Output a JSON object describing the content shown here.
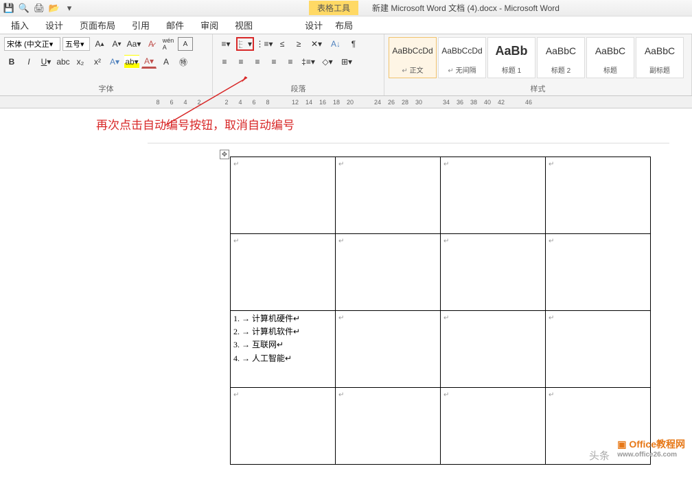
{
  "titlebar": {
    "table_tools": "表格工具",
    "doc_title": "新建 Microsoft Word 文档 (4).docx - Microsoft Word"
  },
  "tabs": {
    "insert": "插入",
    "design": "设计",
    "pagelayout": "页面布局",
    "references": "引用",
    "mailings": "邮件",
    "review": "审阅",
    "view": "视图",
    "table_design": "设计",
    "table_layout": "布局"
  },
  "font": {
    "name": "宋体 (中文正",
    "size": "五号",
    "group_label": "字体"
  },
  "paragraph": {
    "group_label": "段落"
  },
  "styles": {
    "group_label": "样式",
    "items": [
      {
        "preview": "AaBbCcDd",
        "name": "正文",
        "selected": true,
        "has_mark": true
      },
      {
        "preview": "AaBbCcDd",
        "name": "无间隔",
        "has_mark": true
      },
      {
        "preview": "AaBb",
        "name": "标题 1",
        "big": true
      },
      {
        "preview": "AaBbC",
        "name": "标题 2",
        "med": true
      },
      {
        "preview": "AaBbC",
        "name": "标题",
        "med": true
      },
      {
        "preview": "AaBbC",
        "name": "副标题",
        "med": true
      }
    ]
  },
  "ruler": [
    "8",
    "6",
    "4",
    "2",
    "",
    "2",
    "4",
    "6",
    "8",
    "",
    "12",
    "14",
    "16",
    "18",
    "20",
    "",
    "24",
    "26",
    "28",
    "30",
    "",
    "34",
    "36",
    "38",
    "40",
    "42",
    "",
    "46"
  ],
  "annotation": "再次点击自动编号按钮，取消自动编号",
  "table": {
    "list_items": [
      {
        "num": "1.",
        "text": "计算机硬件"
      },
      {
        "num": "2.",
        "text": "计算机软件"
      },
      {
        "num": "3.",
        "text": "互联网"
      },
      {
        "num": "4.",
        "text": "人工智能"
      }
    ]
  },
  "watermarks": {
    "toutiao": "头条",
    "office_name": "Office教程网",
    "office_url": "www.office26.com"
  }
}
